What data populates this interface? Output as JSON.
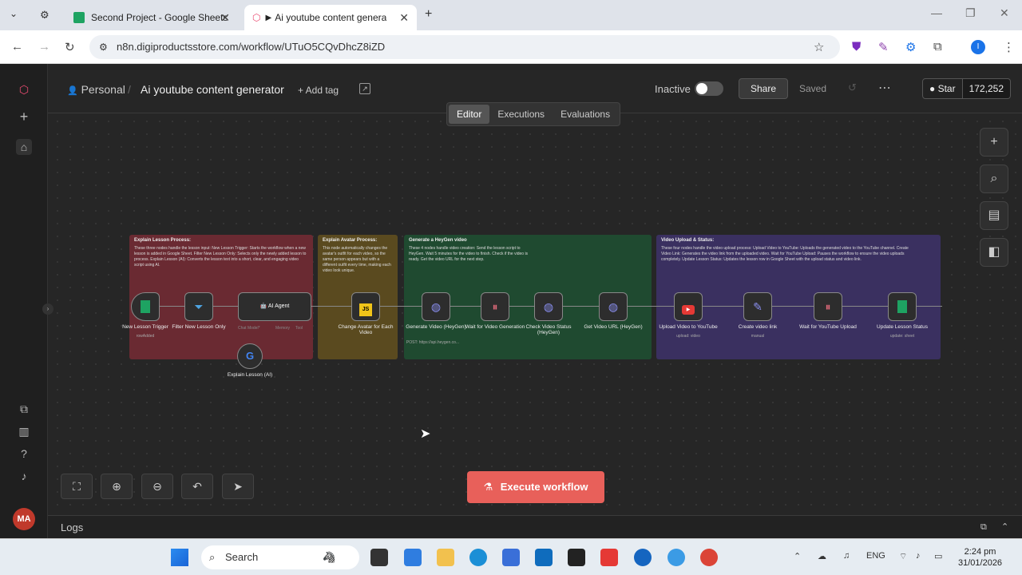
{
  "browser": {
    "tabs": [
      {
        "title": "Second Project - Google Sheets",
        "active": false
      },
      {
        "title": "Ai youtube content generato",
        "active": true
      }
    ],
    "url": "n8n.digiproductsstore.com/workflow/UTuO5CQvDhcZ8iZD"
  },
  "header": {
    "project": "Personal",
    "workflow_title": "Ai youtube content generator",
    "add_tag": "+ Add tag",
    "status": "Inactive",
    "share": "Share",
    "saved": "Saved",
    "github_star": "Star",
    "github_count": "172,252"
  },
  "view_tabs": [
    "Editor",
    "Executions",
    "Evaluations"
  ],
  "groups": [
    {
      "title": "Explain Lesson Process:",
      "body": "These three nodes handle the lesson input: New Lesson Trigger: Starts the workflow when a new lesson is added in Google Sheet. Filter New Lesson Only: Selects only the newly added lesson to process. Explain Lesson (AI): Converts the lesson text into a short, clear, and engaging video script using AI.",
      "color": "#6a2a32"
    },
    {
      "title": "Explain Avatar Process:",
      "body": "This node automatically changes the avatar's outfit for each video, so the same person appears but with a different outfit every time, making each video look unique.",
      "color": "#5a4a1f"
    },
    {
      "title": "Generate a HeyGen video",
      "body": "These 4 nodes handle video creation: Send the lesson script to HeyGen. Wait 5 minutes for the video to finish. Check if the video is ready. Get the video URL for the next step.",
      "color": "#1f4a30"
    },
    {
      "title": "Video Upload & Status:",
      "body": "These four nodes handle the video upload process: Upload Video to YouTube: Uploads the generated video to the YouTube channel. Create Video Link: Generates the video link from the uploaded video. Wait for YouTube Upload: Pauses the workflow to ensure the video uploads completely. Update Lesson Status: Updates the lesson row in Google Sheet with the upload status and video link.",
      "color": "#3a3060"
    }
  ],
  "nodes": [
    {
      "label": "New Lesson Trigger",
      "sub": "rowAdded",
      "icon": "sheets-icon"
    },
    {
      "label": "Filter New Lesson Only",
      "sub": "",
      "icon": "filter-icon"
    },
    {
      "label": "AI Agent",
      "sub": "",
      "icon": "robot-icon"
    },
    {
      "label": "Change Avatar for Each Video",
      "sub": "",
      "icon": "js-icon"
    },
    {
      "label": "Generate Video (HeyGen)",
      "sub": "POST: https://api.heygen.co...",
      "icon": "globe-icon"
    },
    {
      "label": "Wait for Video Generation",
      "sub": "",
      "icon": "pause-icon"
    },
    {
      "label": "Check Video Status (HeyGen)",
      "sub": "",
      "icon": "globe-icon"
    },
    {
      "label": "Get Video URL (HeyGen)",
      "sub": "",
      "icon": "globe-icon"
    },
    {
      "label": "Upload Video to YouTube",
      "sub": "upload: video",
      "icon": "youtube-icon"
    },
    {
      "label": "Create video link",
      "sub": "manual",
      "icon": "pen-icon"
    },
    {
      "label": "Wait for YouTube Upload",
      "sub": "",
      "icon": "pause-icon"
    },
    {
      "label": "Update Lesson Status",
      "sub": "update: sheet",
      "icon": "sheets-icon"
    }
  ],
  "subnode": {
    "label": "Explain Lesson (AI)"
  },
  "agent_ports": [
    "Chat Model*",
    "Memory",
    "Tool"
  ],
  "execute_button": "Execute workflow",
  "logs_label": "Logs",
  "avatar_initials": "MA",
  "taskbar": {
    "search_placeholder": "Search",
    "lang": "ENG",
    "time": "2:24 pm",
    "date": "31/01/2026"
  }
}
